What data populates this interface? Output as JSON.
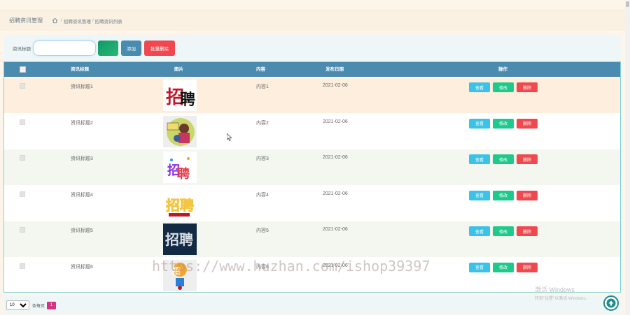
{
  "breadcrumb": {
    "title": "招聘资讯管理",
    "items": [
      "招聘资讯管理",
      "招聘资讯列表"
    ]
  },
  "search": {
    "label": "资讯标题",
    "placeholder": "",
    "value": "",
    "add_label": "添加",
    "batch_delete_label": "批量删除"
  },
  "table": {
    "headers": {
      "title": "资讯标题",
      "image": "图片",
      "content": "内容",
      "date": "发布日期",
      "actions": "操作"
    },
    "rows": [
      {
        "title": "资讯标题1",
        "content": "内容1",
        "date": "2021-02-06"
      },
      {
        "title": "资讯标题2",
        "content": "内容2",
        "date": "2021-02-06"
      },
      {
        "title": "资讯标题3",
        "content": "内容3",
        "date": "2021-02-06"
      },
      {
        "title": "资讯标题4",
        "content": "内容4",
        "date": "2021-02-06"
      },
      {
        "title": "资讯标题5",
        "content": "内容5",
        "date": "2021-02-06"
      },
      {
        "title": "资讯标题6",
        "content": "内容6",
        "date": "2021-02-06"
      }
    ],
    "op_labels": {
      "view": "查看",
      "edit": "修改",
      "delete": "删除"
    }
  },
  "pager": {
    "page_size": "10",
    "per_page_label": "条每页",
    "current_page": "1"
  },
  "overlay": {
    "watermark": "https://www.huzhan.com/ishop39397",
    "activate_line1": "激活 Windows",
    "activate_line2": "转到\"设置\"以激活 Windows。"
  },
  "colors": {
    "header": "#4c8bb0",
    "view": "#3cc2e6",
    "edit": "#1fc98c",
    "delete": "#f0484f",
    "page_active": "#d63384"
  },
  "icons": {
    "home": "home-icon",
    "back_to_top": "arrow-up-icon"
  }
}
